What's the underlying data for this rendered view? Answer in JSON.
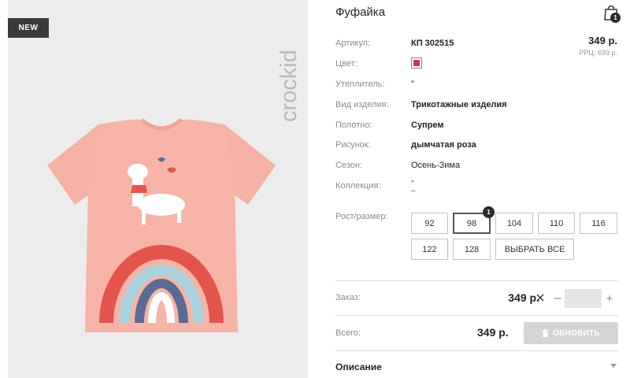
{
  "badge": {
    "label": "NEW"
  },
  "brand": {
    "name": "crockid"
  },
  "product": {
    "title": "Фуфайка",
    "price": "349 р.",
    "rrc": "РРЦ: 699 р.",
    "cart_count": "1"
  },
  "attributes": {
    "article": {
      "label": "Артикул:",
      "value": "КП 302515"
    },
    "color": {
      "label": "Цвет:",
      "value": "#d62f6a"
    },
    "insulation": {
      "label": "Утеплитель:",
      "value": "\""
    },
    "type": {
      "label": "Вид изделия:",
      "value": "Трикотажные изделия"
    },
    "fabric": {
      "label": "Полотно:",
      "value": "Супрем"
    },
    "pattern": {
      "label": "Рисунок:",
      "value": "дымчатая роза"
    },
    "season": {
      "label": "Сезон:",
      "value": "Осень-Зима"
    },
    "collection": {
      "label": "Коллекция:",
      "value_line1": "\"",
      "value_line2": "–"
    }
  },
  "sizes": {
    "label": "Рост/размер:",
    "selected_count": "1",
    "options": [
      "92",
      "98",
      "104",
      "110",
      "116",
      "122",
      "128"
    ],
    "selected": "98",
    "select_all": "ВЫБРАТЬ ВСЕ"
  },
  "order": {
    "label": "Заказ:",
    "price": "349 р.",
    "qty_minus": "–",
    "qty_plus": "+",
    "qty_value": ""
  },
  "total": {
    "label": "Всего:",
    "price": "349 р.",
    "update_label": "ОБНОВИТЬ"
  },
  "description": {
    "title": "Описание"
  },
  "colors": {
    "accent": "#d62f6a",
    "tshirt": "#f6b3a6"
  }
}
